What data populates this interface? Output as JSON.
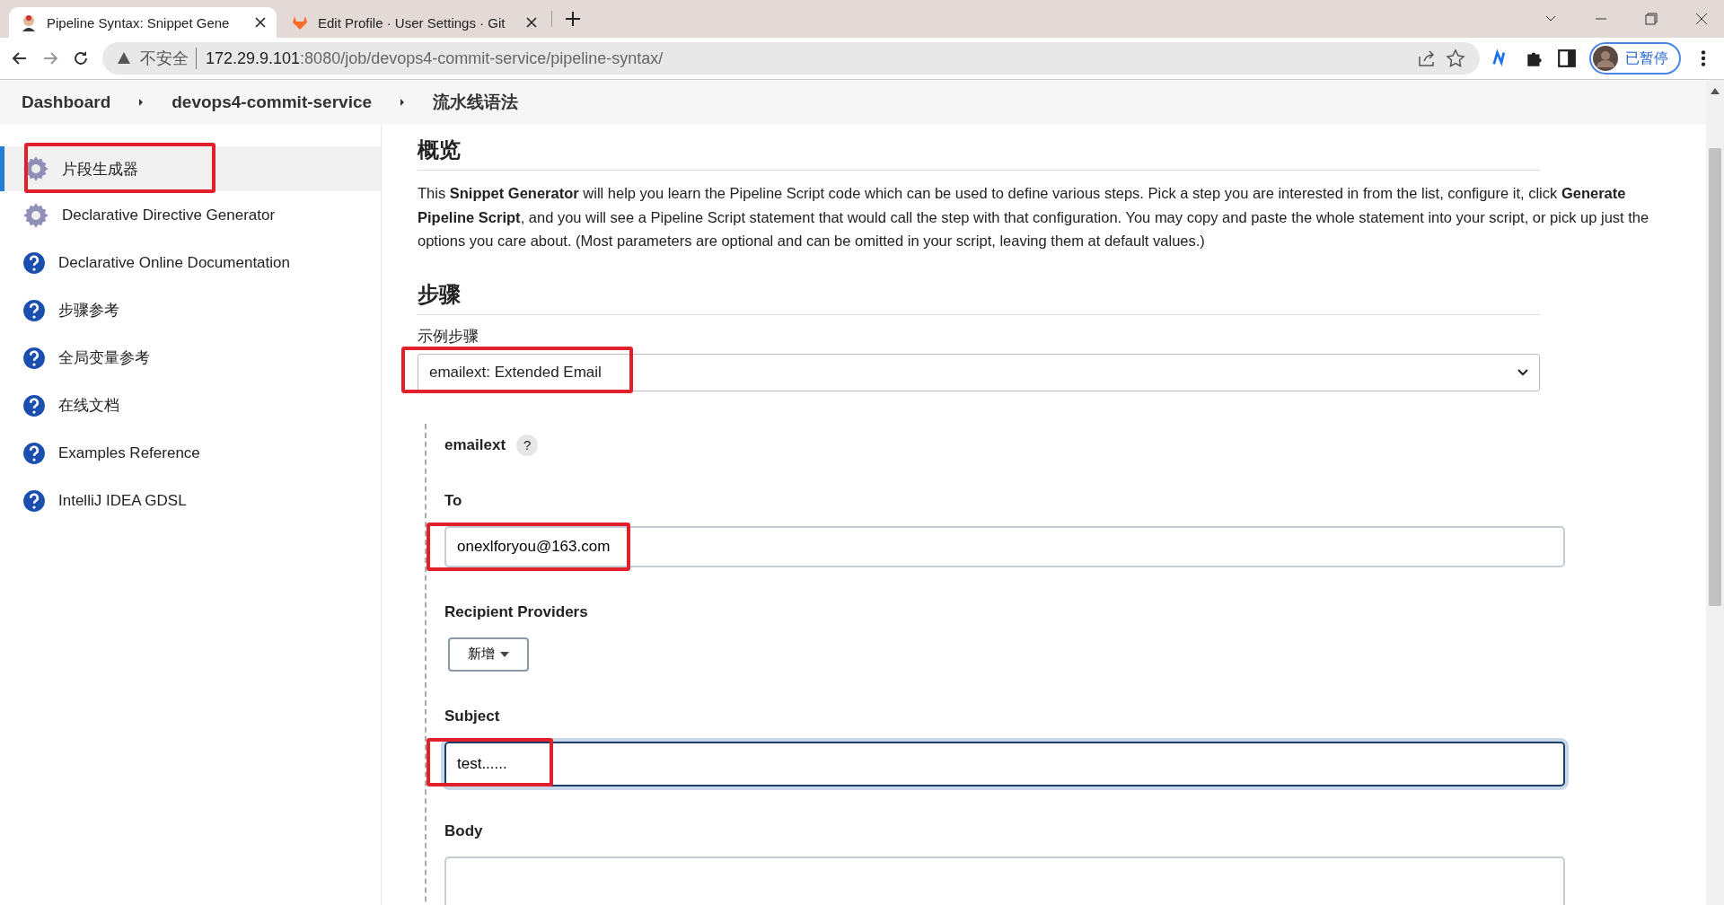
{
  "browser": {
    "tabs": [
      {
        "title": "Pipeline Syntax: Snippet Gene",
        "selected": true
      },
      {
        "title": "Edit Profile · User Settings · Git",
        "selected": false
      }
    ],
    "security": "不安全",
    "url_host": "172.29.9.101",
    "url_path": ":8080/job/devops4-commit-service/pipeline-syntax/",
    "profile_label": "已暂停"
  },
  "breadcrumbs": [
    "Dashboard",
    "devops4-commit-service",
    "流水线语法"
  ],
  "sidebar": {
    "items": [
      {
        "label": "片段生成器",
        "kind": "generator",
        "selected": true,
        "annotated": true
      },
      {
        "label": "Declarative Directive Generator",
        "kind": "generator",
        "selected": false,
        "annotated": false
      },
      {
        "label": "Declarative Online Documentation",
        "kind": "doc",
        "selected": false,
        "annotated": false
      },
      {
        "label": "步骤参考",
        "kind": "doc",
        "selected": false,
        "annotated": false
      },
      {
        "label": "全局变量参考",
        "kind": "doc",
        "selected": false,
        "annotated": false
      },
      {
        "label": "在线文档",
        "kind": "doc",
        "selected": false,
        "annotated": false
      },
      {
        "label": "Examples Reference",
        "kind": "doc",
        "selected": false,
        "annotated": false
      },
      {
        "label": "IntelliJ IDEA GDSL",
        "kind": "doc",
        "selected": false,
        "annotated": false
      }
    ]
  },
  "overview": {
    "heading": "概览",
    "text": "This **Snippet Generator** will help you learn the Pipeline Script code which can be used to define various steps. Pick a step you are interested in from the list, configure it, click **Generate Pipeline Script**, and you will see a Pipeline Script statement that would call the step with that configuration. You may copy and paste the whole statement into your script, or pick up just the options you care about. (Most parameters are optional and can be omitted in your script, leaving them at default values.)"
  },
  "steps": {
    "heading": "步骤",
    "select_label": "示例步骤",
    "select_value": "emailext: Extended Email",
    "select_annotated": true,
    "step_name": "emailext",
    "help_mark": "?",
    "fields": [
      {
        "kind": "input",
        "label": "To",
        "value": "onexlforyou@163.com",
        "focused": false,
        "annotated": true
      },
      {
        "kind": "add",
        "label": "Recipient Providers",
        "button": "新增"
      },
      {
        "kind": "input",
        "label": "Subject",
        "value": "test......",
        "focused": true,
        "annotated": true
      },
      {
        "kind": "textarea",
        "label": "Body"
      }
    ]
  }
}
